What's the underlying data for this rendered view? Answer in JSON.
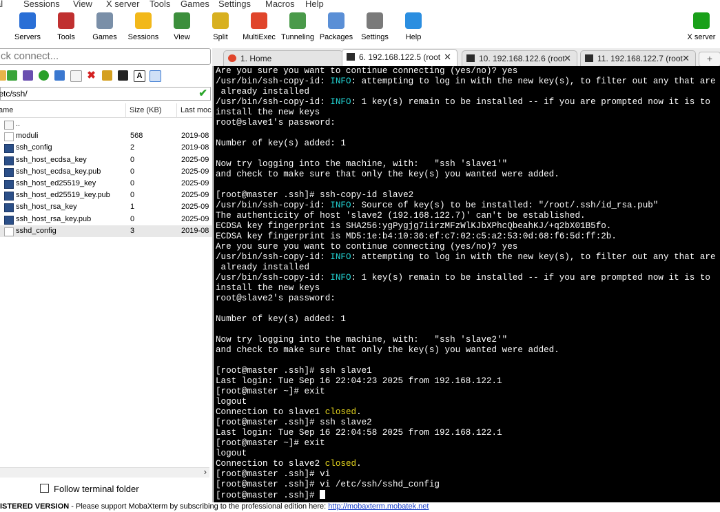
{
  "menu": [
    "al",
    "Sessions",
    "View",
    "X server",
    "Tools",
    "Games",
    "Settings",
    "Macros",
    "Help"
  ],
  "toolbar": [
    {
      "label": "Servers",
      "icon": "servers-icon",
      "color": "#2a6fd6"
    },
    {
      "label": "Tools",
      "icon": "tools-icon",
      "color": "#c03030"
    },
    {
      "label": "Games",
      "icon": "games-icon",
      "color": "#7a8fa8"
    },
    {
      "label": "Sessions",
      "icon": "sessions-star-icon",
      "color": "#f2b81a"
    },
    {
      "label": "View",
      "icon": "view-icon",
      "color": "#3c8f3c"
    },
    {
      "label": "Split",
      "icon": "split-icon",
      "color": "#d8b020"
    },
    {
      "label": "MultiExec",
      "icon": "multiexec-icon",
      "color": "#e0452b"
    },
    {
      "label": "Tunneling",
      "icon": "tunneling-icon",
      "color": "#4a9a4a"
    },
    {
      "label": "Packages",
      "icon": "packages-icon",
      "color": "#5a8fd6"
    },
    {
      "label": "Settings",
      "icon": "settings-icon",
      "color": "#7a7a7a"
    },
    {
      "label": "Help",
      "icon": "help-icon",
      "color": "#2b8ee0"
    },
    {
      "label": "X server",
      "icon": "x-server-icon",
      "color": "#1aa01a"
    }
  ],
  "quick_connect": {
    "placeholder": "ck connect..."
  },
  "path": "/etc/ssh/",
  "file_columns": {
    "name": "ame",
    "size": "Size (KB)",
    "modified": "Last moc"
  },
  "files": [
    {
      "name": "..",
      "size": "",
      "date": "",
      "type": "folder"
    },
    {
      "name": "moduli",
      "size": "568",
      "date": "2019-08",
      "type": "doc"
    },
    {
      "name": "ssh_config",
      "size": "2",
      "date": "2019-08",
      "type": "term"
    },
    {
      "name": "ssh_host_ecdsa_key",
      "size": "0",
      "date": "2025-09",
      "type": "term"
    },
    {
      "name": "ssh_host_ecdsa_key.pub",
      "size": "0",
      "date": "2025-09",
      "type": "term"
    },
    {
      "name": "ssh_host_ed25519_key",
      "size": "0",
      "date": "2025-09",
      "type": "term"
    },
    {
      "name": "ssh_host_ed25519_key.pub",
      "size": "0",
      "date": "2025-09",
      "type": "term"
    },
    {
      "name": "ssh_host_rsa_key",
      "size": "1",
      "date": "2025-09",
      "type": "term"
    },
    {
      "name": "ssh_host_rsa_key.pub",
      "size": "0",
      "date": "2025-09",
      "type": "term"
    },
    {
      "name": "sshd_config",
      "size": "3",
      "date": "2019-08",
      "type": "doc",
      "selected": true
    }
  ],
  "follow_terminal_label": "Follow terminal folder",
  "tabs": [
    {
      "label": "1. Home",
      "active": false,
      "closable": false
    },
    {
      "label": "6. 192.168.122.5 (root",
      "active": true,
      "closable": true
    },
    {
      "label": "10. 192.168.122.6 (root",
      "active": false,
      "closable": true
    },
    {
      "label": "11. 192.168.122.7 (root",
      "active": false,
      "closable": true
    }
  ],
  "terminal": [
    [
      [
        "Are you sure you want to continue connecting (yes/no)? yes",
        ""
      ]
    ],
    [
      [
        "/usr/bin/ssh-copy-id: ",
        ""
      ],
      [
        "INFO",
        "cyan"
      ],
      [
        ": attempting to log in with the new key(s), to filter out any that are",
        ""
      ]
    ],
    [
      [
        " already installed",
        ""
      ]
    ],
    [
      [
        "/usr/bin/ssh-copy-id: ",
        ""
      ],
      [
        "INFO",
        "cyan"
      ],
      [
        ": 1 key(s) remain to be installed -- if you are prompted now it is to",
        ""
      ]
    ],
    [
      [
        "install the new keys",
        ""
      ]
    ],
    [
      [
        "root@slave1's password:",
        ""
      ]
    ],
    [
      [
        "",
        ""
      ]
    ],
    [
      [
        "Number of key(s) added: 1",
        ""
      ]
    ],
    [
      [
        "",
        ""
      ]
    ],
    [
      [
        "Now try logging into the machine, with:   \"ssh 'slave1'\"",
        ""
      ]
    ],
    [
      [
        "and check to make sure that only the key(s) you wanted were added.",
        ""
      ]
    ],
    [
      [
        "",
        ""
      ]
    ],
    [
      [
        "[root@master .ssh]# ssh-copy-id slave2",
        ""
      ]
    ],
    [
      [
        "/usr/bin/ssh-copy-id: ",
        ""
      ],
      [
        "INFO",
        "cyan"
      ],
      [
        ": Source of key(s) to be installed: \"/root/.ssh/id_rsa.pub\"",
        ""
      ]
    ],
    [
      [
        "The authenticity of host 'slave2 (192.168.122.7)' can't be established.",
        ""
      ]
    ],
    [
      [
        "ECDSA key fingerprint is SHA256:ygPygjg7iirzMFzWlKJbXPhcQbeahKJ/+q2bX01B5fo.",
        ""
      ]
    ],
    [
      [
        "ECDSA key fingerprint is MD5:1e:b4:10:36:ef:c7:02:c5:a2:53:0d:68:f6:5d:ff:2b.",
        ""
      ]
    ],
    [
      [
        "Are you sure you want to continue connecting (yes/no)? yes",
        ""
      ]
    ],
    [
      [
        "/usr/bin/ssh-copy-id: ",
        ""
      ],
      [
        "INFO",
        "cyan"
      ],
      [
        ": attempting to log in with the new key(s), to filter out any that are",
        ""
      ]
    ],
    [
      [
        " already installed",
        ""
      ]
    ],
    [
      [
        "/usr/bin/ssh-copy-id: ",
        ""
      ],
      [
        "INFO",
        "cyan"
      ],
      [
        ": 1 key(s) remain to be installed -- if you are prompted now it is to",
        ""
      ]
    ],
    [
      [
        "install the new keys",
        ""
      ]
    ],
    [
      [
        "root@slave2's password:",
        ""
      ]
    ],
    [
      [
        "",
        ""
      ]
    ],
    [
      [
        "Number of key(s) added: 1",
        ""
      ]
    ],
    [
      [
        "",
        ""
      ]
    ],
    [
      [
        "Now try logging into the machine, with:   \"ssh 'slave2'\"",
        ""
      ]
    ],
    [
      [
        "and check to make sure that only the key(s) you wanted were added.",
        ""
      ]
    ],
    [
      [
        "",
        ""
      ]
    ],
    [
      [
        "[root@master .ssh]# ssh slave1",
        ""
      ]
    ],
    [
      [
        "Last login: Tue Sep 16 22:04:23 2025 from 192.168.122.1",
        ""
      ]
    ],
    [
      [
        "[root@master ~]# exit",
        ""
      ]
    ],
    [
      [
        "logout",
        ""
      ]
    ],
    [
      [
        "Connection to slave1 ",
        ""
      ],
      [
        "closed",
        "yellow"
      ],
      [
        ".",
        ""
      ]
    ],
    [
      [
        "[root@master .ssh]# ssh slave2",
        ""
      ]
    ],
    [
      [
        "Last login: Tue Sep 16 22:04:58 2025 from 192.168.122.1",
        ""
      ]
    ],
    [
      [
        "[root@master ~]# exit",
        ""
      ]
    ],
    [
      [
        "logout",
        ""
      ]
    ],
    [
      [
        "Connection to slave2 ",
        ""
      ],
      [
        "closed",
        "yellow"
      ],
      [
        ".",
        ""
      ]
    ],
    [
      [
        "[root@master .ssh]# vi",
        ""
      ]
    ],
    [
      [
        "[root@master .ssh]# vi /etc/ssh/sshd_config",
        ""
      ]
    ],
    [
      [
        "[root@master .ssh]# ",
        ""
      ]
    ]
  ],
  "status": {
    "prefix": "ISTERED VERSION",
    "text": "  -  Please support MobaXterm by subscribing to the professional edition here:  ",
    "link": "http://mobaxterm.mobatek.net"
  }
}
